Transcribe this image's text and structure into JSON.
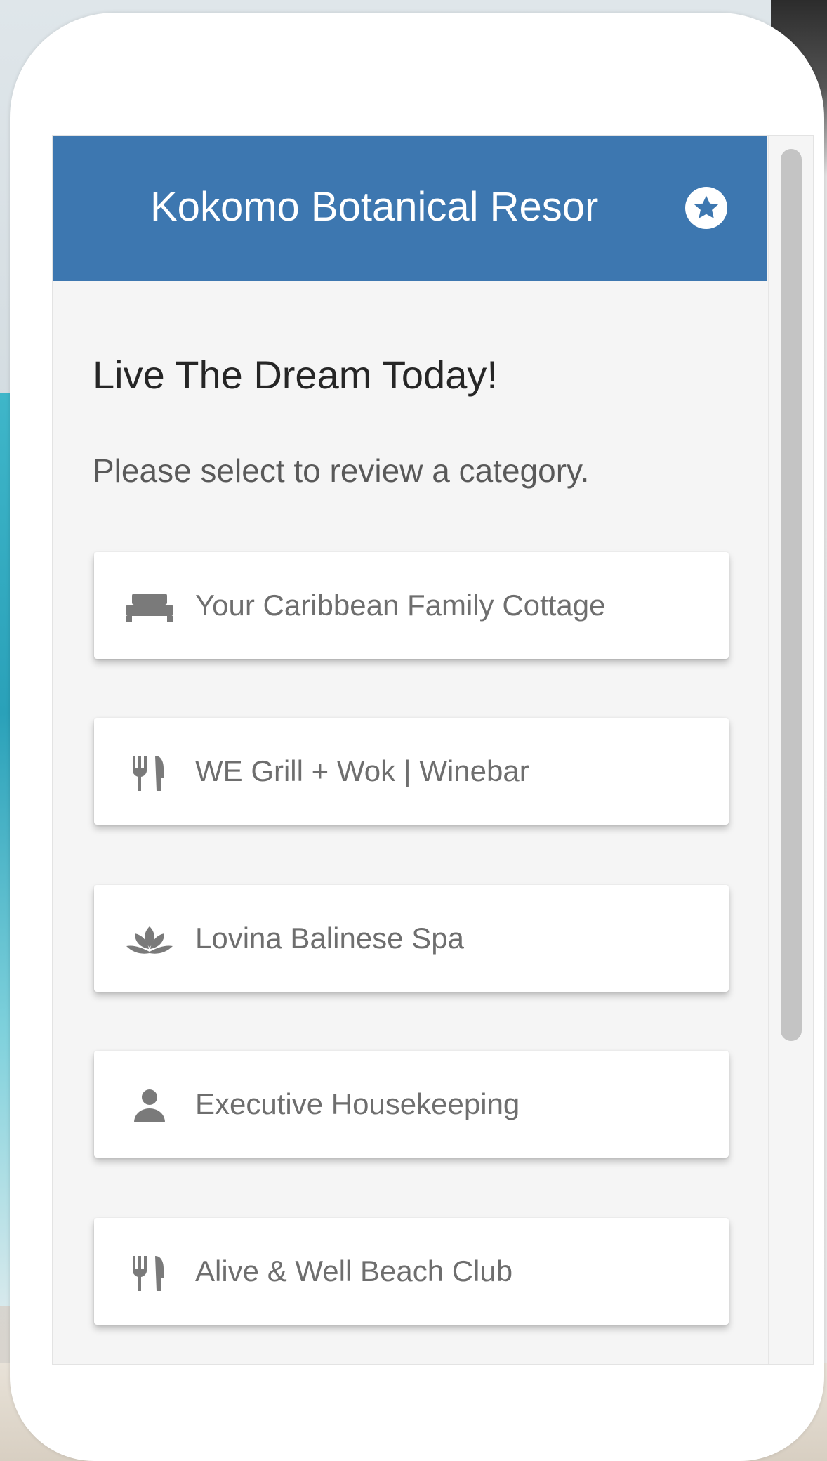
{
  "header": {
    "title": "Kokomo Botanical Resor",
    "badge_icon": "star-circle-icon",
    "background_color": "#3d77b0"
  },
  "main": {
    "heading": "Live The Dream Today!",
    "subheading": "Please select to review a category."
  },
  "categories": [
    {
      "label": "Your Caribbean Family Cottage",
      "icon": "bed-icon"
    },
    {
      "label": "WE Grill + Wok | Winebar",
      "icon": "utensils-icon"
    },
    {
      "label": "Lovina Balinese Spa",
      "icon": "lotus-icon"
    },
    {
      "label": "Executive Housekeeping",
      "icon": "person-icon"
    },
    {
      "label": "Alive & Well Beach Club",
      "icon": "utensils-icon"
    }
  ]
}
